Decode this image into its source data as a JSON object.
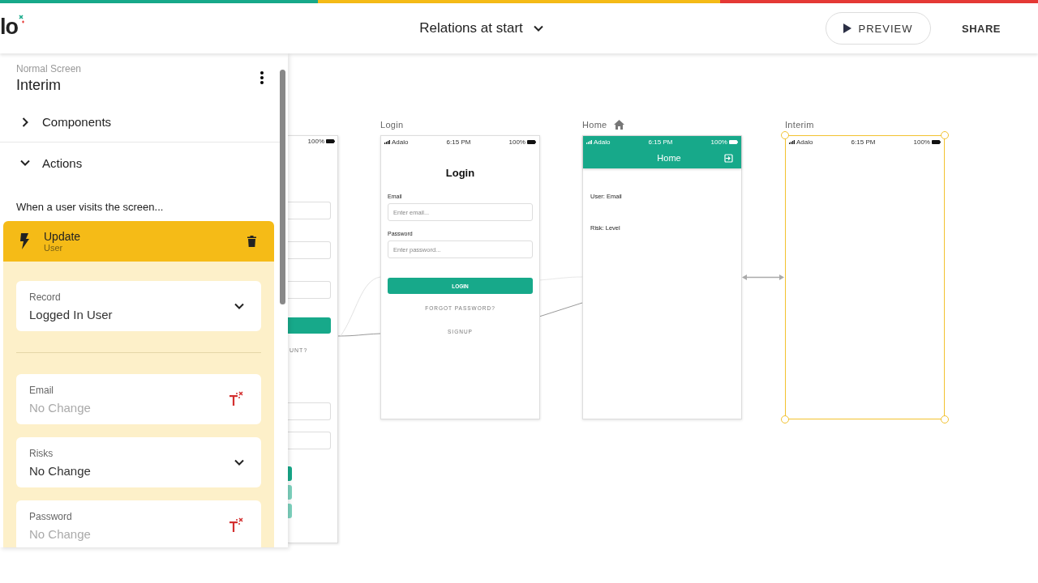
{
  "app_bar": {
    "logo": "lo",
    "title": "Relations at start",
    "buttons": [
      {
        "kind": "preview",
        "label": "PREVIEW"
      },
      {
        "kind": "share",
        "label": "SHARE"
      }
    ]
  },
  "panel": {
    "subtitle": "Normal Screen",
    "title": "Interim",
    "sections": [
      {
        "label": "Components",
        "expanded": false
      },
      {
        "label": "Actions",
        "expanded": true
      }
    ],
    "trigger": "When a user visits the screen...",
    "action": {
      "title": "Update",
      "subtitle": "User",
      "record": {
        "label": "Record",
        "value": "Logged In User"
      },
      "fields": [
        {
          "kind": "text",
          "label": "Email",
          "placeholder": "No Change"
        },
        {
          "kind": "select",
          "label": "Risks",
          "value": "No Change"
        },
        {
          "kind": "text",
          "label": "Password",
          "placeholder": "No Change"
        }
      ]
    }
  },
  "canvas": {
    "partial_screen": {
      "battery": "100%",
      "text": "UNT?"
    },
    "screens": [
      {
        "kind": "login",
        "label": "Login",
        "is_home": false,
        "selected": false,
        "carrier": "Adalo",
        "time": "6:15 PM",
        "battery": "100%",
        "title": "Login",
        "fields": [
          {
            "label": "Email",
            "placeholder": "Enter email..."
          },
          {
            "label": "Password",
            "placeholder": "Enter password..."
          }
        ],
        "button": "LOGIN",
        "links": [
          "FORGOT PASSWORD?",
          "SIGNUP"
        ]
      },
      {
        "kind": "home",
        "label": "Home",
        "is_home": true,
        "selected": false,
        "carrier": "Adalo",
        "time": "6:15 PM",
        "battery": "100%",
        "title": "Home",
        "texts": [
          "User: Email",
          "Risk: Level"
        ]
      },
      {
        "kind": "blank",
        "label": "Interim",
        "is_home": false,
        "selected": true,
        "carrier": "Adalo",
        "time": "6:15 PM",
        "battery": "100%"
      }
    ]
  }
}
